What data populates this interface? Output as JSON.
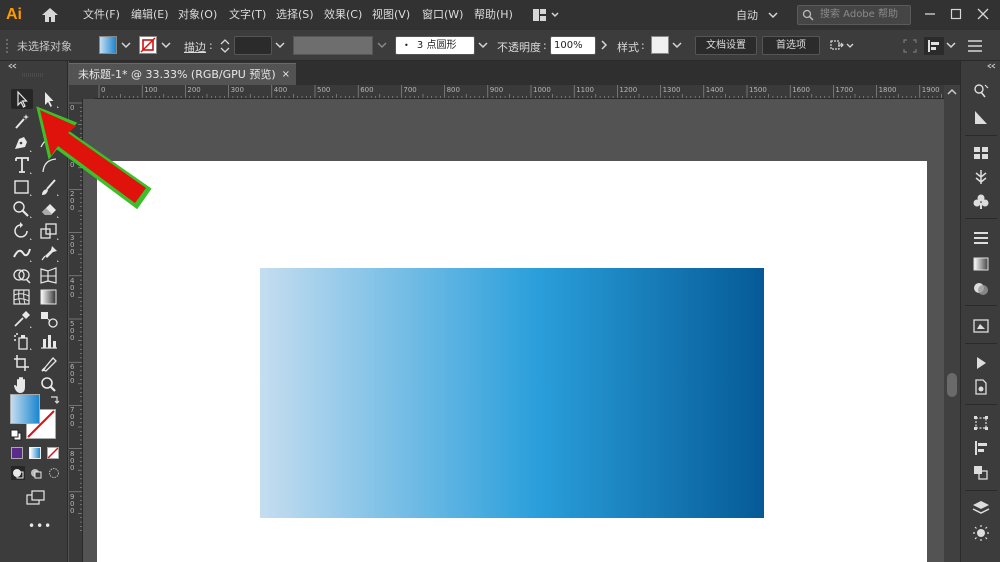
{
  "app": {
    "logo": "Ai",
    "menus": [
      "文件(F)",
      "编辑(E)",
      "对象(O)",
      "文字(T)",
      "选择(S)",
      "效果(C)",
      "视图(V)",
      "窗口(W)",
      "帮助(H)"
    ],
    "workspace": "自动",
    "search_placeholder": "搜索 Adobe 帮助"
  },
  "control_bar": {
    "selection_status": "未选择对象",
    "stroke_label": "描边",
    "brush_value": "3 点圆形",
    "opacity_label": "不透明度",
    "opacity_value": "100%",
    "style_label": "样式",
    "doc_setup_label": "文档设置",
    "preferences_label": "首选项"
  },
  "document": {
    "tab_title": "未标题-1* @ 33.33% (RGB/GPU 预览)",
    "tab_close": "×"
  },
  "rulers": {
    "horizontal": [
      "0",
      "100",
      "200",
      "300",
      "400",
      "500",
      "600",
      "700",
      "800",
      "900",
      "1000",
      "1100",
      "1200",
      "1300",
      "1400",
      "1500",
      "1600",
      "1700",
      "1800",
      "1900"
    ],
    "vertical": [
      "0",
      "1\n0\n0",
      "2\n0\n0",
      "3\n0\n0",
      "4\n0\n0",
      "5\n0\n0",
      "6\n0\n0",
      "7\n0\n0",
      "8\n0\n0",
      "9\n0\n0"
    ]
  },
  "colors": {
    "logo": "#ff9a00",
    "gradient_start": "#c5ddf0",
    "gradient_mid": "#2a9fdb",
    "gradient_end": "#055a96",
    "annotation_arrow": "#e0120c",
    "annotation_outline": "#3bbf2a",
    "fill_swatch": "#1b86cf"
  },
  "toolbox": {
    "tools": [
      "selection-tool",
      "direct-selection-tool",
      "magic-wand-tool",
      "lasso-tool",
      "pen-tool",
      "curvature-tool",
      "type-tool",
      "line-segment-tool",
      "rectangle-tool",
      "paintbrush-tool",
      "shaper-tool",
      "eraser-tool",
      "rotate-tool",
      "scale-tool",
      "width-tool",
      "puppet-warp-tool",
      "shape-builder-tool",
      "perspective-grid-tool",
      "mesh-tool",
      "gradient-tool",
      "eyedropper-tool",
      "blend-tool",
      "symbol-sprayer-tool",
      "column-graph-tool",
      "artboard-tool",
      "slice-tool",
      "hand-tool",
      "zoom-tool"
    ],
    "more_label": "•••"
  }
}
